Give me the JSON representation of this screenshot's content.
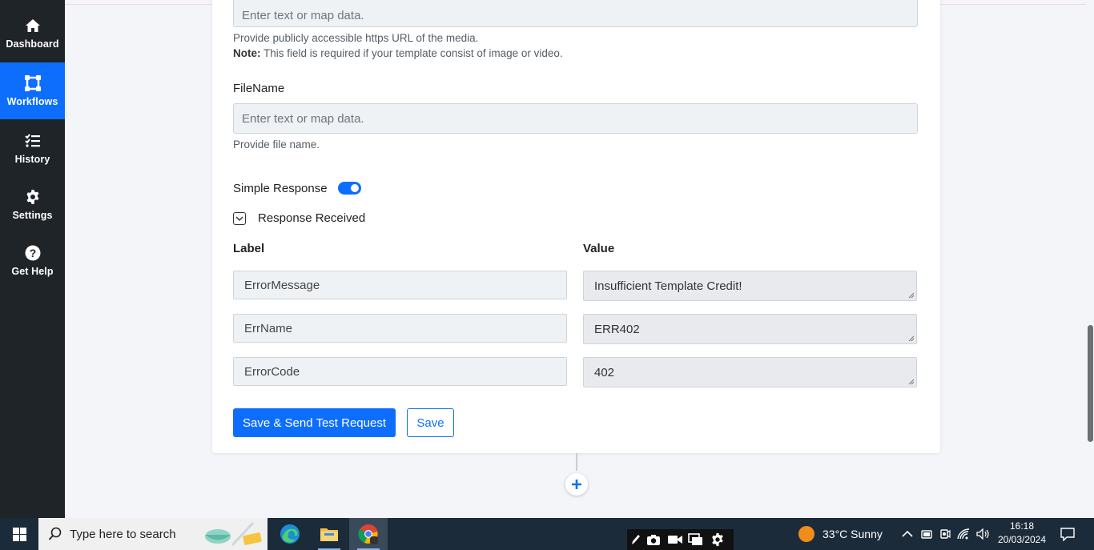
{
  "sidebar": {
    "items": [
      {
        "label": "Dashboard",
        "icon": "home-icon"
      },
      {
        "label": "Workflows",
        "icon": "workflow-icon",
        "active": true
      },
      {
        "label": "History",
        "icon": "history-list-icon"
      },
      {
        "label": "Settings",
        "icon": "gear-icon"
      },
      {
        "label": "Get Help",
        "icon": "help-icon"
      }
    ]
  },
  "form": {
    "media_url": {
      "placeholder": "Enter text or map data.",
      "help": "Provide publicly accessible https URL of the media.",
      "note_bold": "Note:",
      "note": " This field is required if your template consist of image or video."
    },
    "filename": {
      "label": "FileName",
      "placeholder": "Enter text or map data.",
      "help": "Provide file name."
    },
    "simple_response": {
      "label": "Simple Response",
      "enabled": true
    },
    "response_received": {
      "label": "Response Received",
      "expanded": true
    },
    "table": {
      "label_header": "Label",
      "value_header": "Value",
      "rows": [
        {
          "label": "ErrorMessage",
          "value": "Insufficient Template Credit!"
        },
        {
          "label": "ErrName",
          "value": "ERR402"
        },
        {
          "label": "ErrorCode",
          "value": "402"
        }
      ]
    },
    "buttons": {
      "save_send": "Save & Send Test Request",
      "save": "Save"
    }
  },
  "taskbar": {
    "search_placeholder": "Type here to search",
    "weather": "33°C  Sunny",
    "time": "16:18",
    "date": "20/03/2024"
  },
  "colors": {
    "accent": "#0d6efd",
    "sidebar_bg": "#1f2429",
    "page_bg": "#f3f5f8"
  }
}
